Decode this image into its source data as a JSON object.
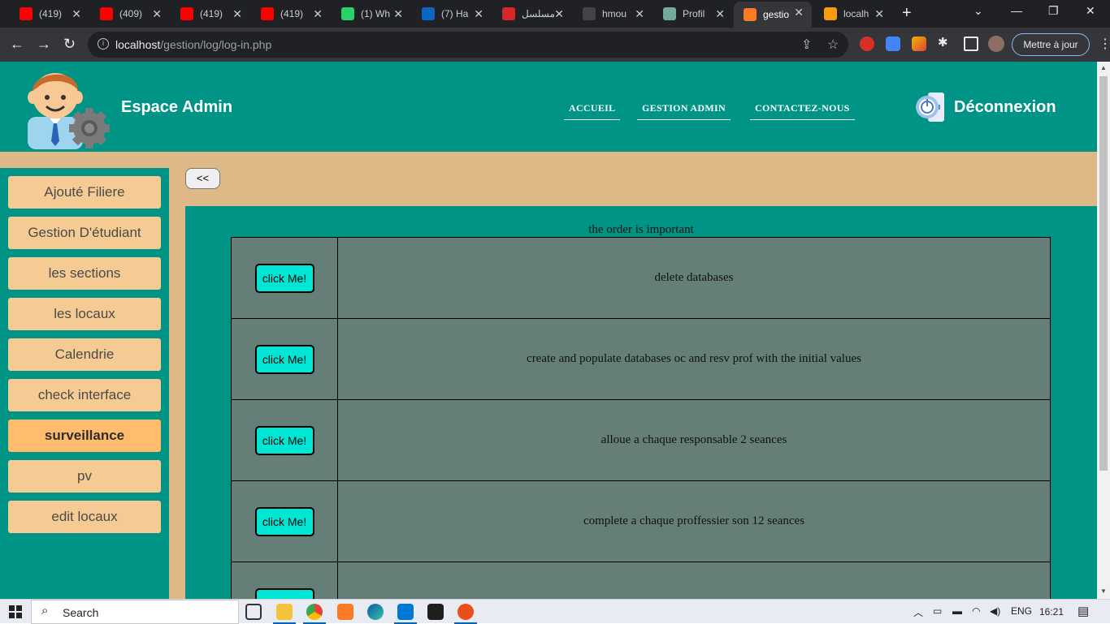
{
  "browser": {
    "tabs": [
      {
        "title": "(419)",
        "favicon": "youtube-icon",
        "color": "#ff0000"
      },
      {
        "title": "(409)",
        "favicon": "youtube-icon",
        "color": "#ff0000"
      },
      {
        "title": "(419)",
        "favicon": "youtube-icon",
        "color": "#ff0000"
      },
      {
        "title": "(419)",
        "favicon": "youtube-icon",
        "color": "#ff0000"
      },
      {
        "title": "(1) Wh",
        "favicon": "whatsapp-icon",
        "color": "#25d366"
      },
      {
        "title": "(7) Ha",
        "favicon": "linkedin-icon",
        "color": "#0a66c2"
      },
      {
        "title": "مسلسل",
        "favicon": "heart-icon",
        "color": "#d62828"
      },
      {
        "title": "hmou",
        "favicon": "github-icon",
        "color": "#444444"
      },
      {
        "title": "Profil",
        "favicon": "openai-icon",
        "color": "#74aa9c"
      },
      {
        "title": "gestio",
        "favicon": "xampp-icon",
        "color": "#fb7a24"
      },
      {
        "title": "localh",
        "favicon": "phpmyadmin-icon",
        "color": "#f89c0e"
      }
    ],
    "active_tab_index": 9,
    "url_host": "localhost",
    "url_path": "/gestion/log/log-in.php",
    "update_label": "Mettre à jour"
  },
  "header": {
    "title": "Espace Admin",
    "nav": [
      "ACCUEIL",
      "GESTION ADMIN",
      "CONTACTEZ-NOUS"
    ],
    "logout_label": "Déconnexion"
  },
  "sidebar": {
    "items": [
      "Ajouté Filiere",
      "Gestion D'étudiant",
      "les sections",
      "les locaux",
      "Calendrie",
      "check interface",
      "surveillance",
      "pv",
      "edit locaux"
    ],
    "active_item": "surveillance"
  },
  "back_button": "<<",
  "main": {
    "caption": "the order is important",
    "rows": [
      {
        "button": "click Me!",
        "description": "delete databases"
      },
      {
        "button": "click Me!",
        "description": "create and populate databases oc and resv prof with the initial values"
      },
      {
        "button": "click Me!",
        "description": "alloue a chaque responsable 2 seances"
      },
      {
        "button": "click Me!",
        "description": "complete a chaque proffessier son 12 seances"
      },
      {
        "button": "click Me!",
        "description": ""
      }
    ]
  },
  "taskbar": {
    "search_label": "Search",
    "language": "ENG",
    "time": "16:21"
  },
  "colors": {
    "teal": "#009486",
    "sand": "#dfb888",
    "sidebar_button": "#f5cb93",
    "sidebar_active": "#ffbb6e",
    "table_bg": "#657f78",
    "action_button": "#00e6d4"
  }
}
